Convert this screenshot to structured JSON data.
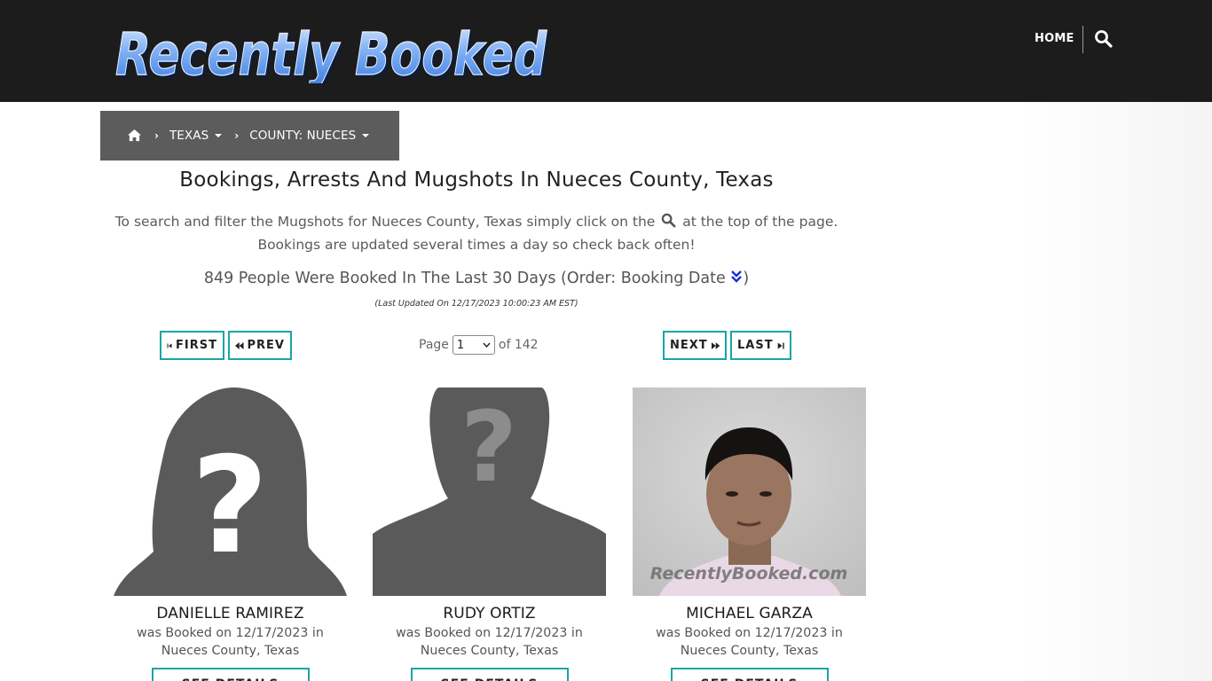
{
  "header": {
    "logo_text": "Recently Booked",
    "nav_home": "HOME",
    "search_icon": "search-icon"
  },
  "breadcrumb": {
    "home_icon": "home-icon",
    "items": [
      {
        "label": "TEXAS"
      },
      {
        "label": "COUNTY: NUECES"
      }
    ]
  },
  "main": {
    "title": "Bookings, Arrests And Mugshots In Nueces County, Texas",
    "intro_part1": "To search and filter the Mugshots for Nueces County, Texas simply click on the",
    "intro_part2": "at the top of the page. Bookings are updated several times a day so check back often!",
    "count_text": "849 People Were Booked In The Last 30 Days (Order: Booking Date",
    "count_close": ")",
    "updated": "(Last Updated On 12/17/2023 10:00:23 AM EST)"
  },
  "pager": {
    "first": "FIRST",
    "prev": "PREV",
    "next": "NEXT",
    "last": "LAST",
    "page_label": "Page",
    "page_value": "1",
    "of_label": "of 142"
  },
  "cards": [
    {
      "name": "DANIELLE RAMIREZ",
      "booked": "was Booked on 12/17/2023 in",
      "location": "Nueces County, Texas",
      "details": "SEE DETAILS",
      "photo": "female-silhouette-placeholder"
    },
    {
      "name": "RUDY ORTIZ",
      "booked": "was Booked on 12/17/2023 in",
      "location": "Nueces County, Texas",
      "details": "SEE DETAILS",
      "photo": "male-silhouette-placeholder"
    },
    {
      "name": "MICHAEL GARZA",
      "booked": "was Booked on 12/17/2023 in",
      "location": "Nueces County, Texas",
      "details": "SEE DETAILS",
      "photo": "mugshot-photo",
      "watermark": "RecentlyBooked.com"
    }
  ],
  "colors": {
    "header_bg": "#1c1c1c",
    "breadcrumb_bg": "#5c5c5c",
    "button_border": "#1aa5a5",
    "logo_blue": "#5b9bf0"
  }
}
